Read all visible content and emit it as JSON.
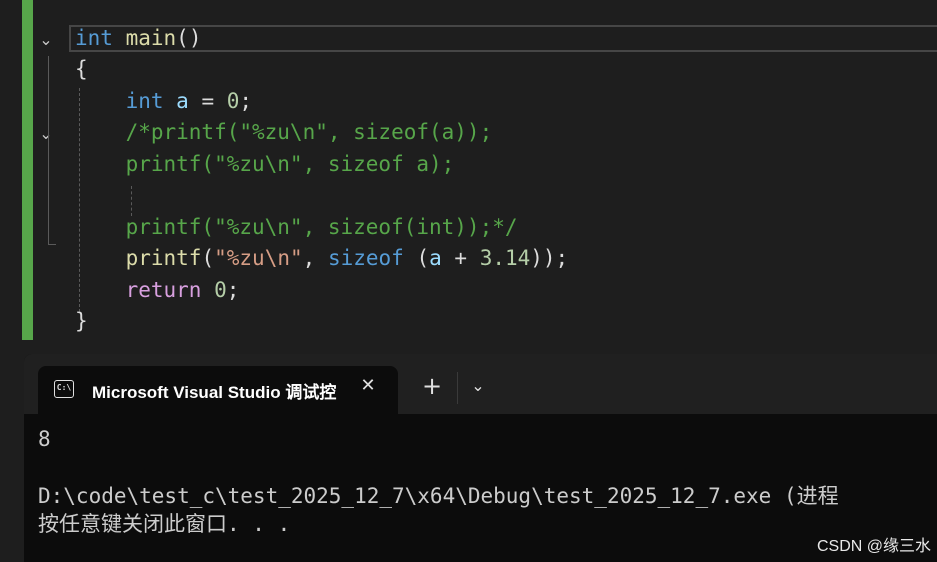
{
  "editor": {
    "lines": [
      [
        {
          "t": "int",
          "c": "kw"
        },
        {
          "t": " ",
          "c": "pl"
        },
        {
          "t": "main",
          "c": "fn"
        },
        {
          "t": "()",
          "c": "pl"
        }
      ],
      [
        {
          "t": "{",
          "c": "pl"
        }
      ],
      [
        {
          "t": "    ",
          "c": "pl"
        },
        {
          "t": "int",
          "c": "kw"
        },
        {
          "t": " ",
          "c": "pl"
        },
        {
          "t": "a",
          "c": "var"
        },
        {
          "t": " = ",
          "c": "pl"
        },
        {
          "t": "0",
          "c": "num"
        },
        {
          "t": ";",
          "c": "pl"
        }
      ],
      [
        {
          "t": "    /*printf(\"%zu\\n\", sizeof(a));",
          "c": "cmt"
        }
      ],
      [
        {
          "t": "    printf(\"%zu\\n\", sizeof a);",
          "c": "cmt"
        }
      ],
      [
        {
          "t": "",
          "c": "cmt"
        }
      ],
      [
        {
          "t": "    printf(\"%zu\\n\", sizeof(int));*/",
          "c": "cmt"
        }
      ],
      [
        {
          "t": "    ",
          "c": "pl"
        },
        {
          "t": "printf",
          "c": "fn"
        },
        {
          "t": "(",
          "c": "pl"
        },
        {
          "t": "\"",
          "c": "str"
        },
        {
          "t": "%zu",
          "c": "str"
        },
        {
          "t": "\\n",
          "c": "str"
        },
        {
          "t": "\"",
          "c": "str"
        },
        {
          "t": ", ",
          "c": "pl"
        },
        {
          "t": "sizeof",
          "c": "kw"
        },
        {
          "t": " (",
          "c": "pl"
        },
        {
          "t": "a",
          "c": "var"
        },
        {
          "t": " + ",
          "c": "pl"
        },
        {
          "t": "3.14",
          "c": "num"
        },
        {
          "t": "));",
          "c": "pl"
        }
      ],
      [
        {
          "t": "    ",
          "c": "pl"
        },
        {
          "t": "return",
          "c": "ctl"
        },
        {
          "t": " ",
          "c": "pl"
        },
        {
          "t": "0",
          "c": "num"
        },
        {
          "t": ";",
          "c": "pl"
        }
      ],
      [
        {
          "t": "}",
          "c": "pl"
        }
      ]
    ],
    "fold_icon": "chevron-down-icon"
  },
  "terminal": {
    "tab_title": "Microsoft Visual Studio 调试控",
    "tab_icon_label": "C:\\",
    "close_glyph": "✕",
    "new_tab_glyph": "+",
    "dropdown_glyph": "⌄",
    "output": [
      "8",
      "",
      "D:\\code\\test_c\\test_2025_12_7\\x64\\Debug\\test_2025_12_7.exe (进程",
      "按任意键关闭此窗口. . ."
    ]
  },
  "watermark": "CSDN @缘三水",
  "colors": {
    "change_bar": "#57a64a",
    "keyword": "#569cd6",
    "function": "#dcdcaa",
    "comment": "#57a64a",
    "terminal_bg": "#0c0c0c"
  }
}
